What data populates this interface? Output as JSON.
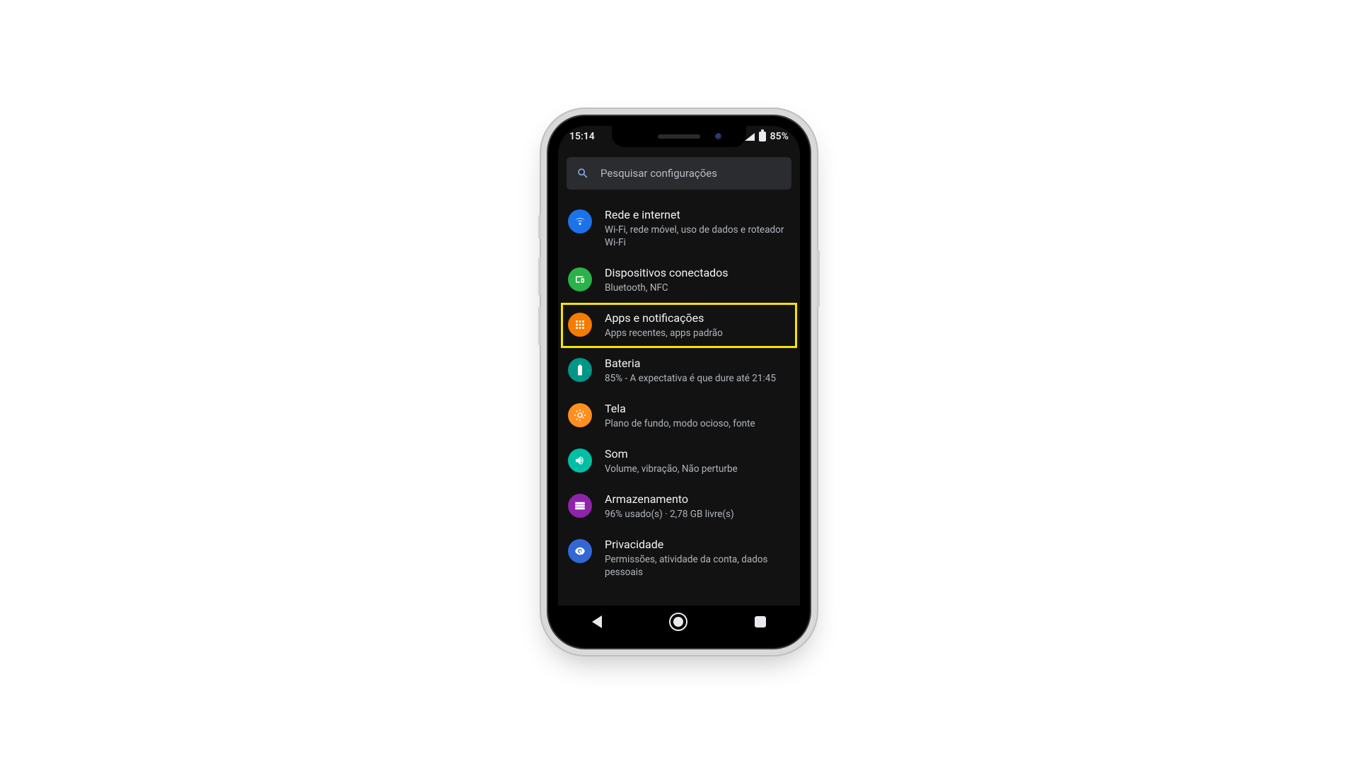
{
  "status": {
    "time": "15:14",
    "battery": "85%"
  },
  "search": {
    "placeholder": "Pesquisar configurações"
  },
  "settings": [
    {
      "id": "network",
      "icon": "wifi-icon",
      "color": "bg-blue",
      "title": "Rede e internet",
      "subtitle": "Wi-Fi, rede móvel, uso de dados e roteador Wi-Fi",
      "highlight": false
    },
    {
      "id": "devices",
      "icon": "devices-icon",
      "color": "bg-green",
      "title": "Dispositivos conectados",
      "subtitle": "Bluetooth, NFC",
      "highlight": false
    },
    {
      "id": "apps",
      "icon": "apps-icon",
      "color": "bg-orange",
      "title": "Apps e notificações",
      "subtitle": "Apps recentes, apps padrão",
      "highlight": true
    },
    {
      "id": "battery",
      "icon": "battery-icon",
      "color": "bg-teal",
      "title": "Bateria",
      "subtitle": "85% - A expectativa é que dure até 21:45",
      "highlight": false
    },
    {
      "id": "display",
      "icon": "display-icon",
      "color": "bg-orange2",
      "title": "Tela",
      "subtitle": "Plano de fundo, modo ocioso, fonte",
      "highlight": false
    },
    {
      "id": "sound",
      "icon": "sound-icon",
      "color": "bg-teal2",
      "title": "Som",
      "subtitle": "Volume, vibração, Não perturbe",
      "highlight": false
    },
    {
      "id": "storage",
      "icon": "storage-icon",
      "color": "bg-purple",
      "title": "Armazenamento",
      "subtitle": "96% usado(s) · 2,78 GB livre(s)",
      "highlight": false
    },
    {
      "id": "privacy",
      "icon": "privacy-icon",
      "color": "bg-blue2",
      "title": "Privacidade",
      "subtitle": "Permissões, atividade da conta, dados pessoais",
      "highlight": false
    }
  ],
  "icons": {
    "wifi-icon": "wifi",
    "devices-icon": "devices",
    "apps-icon": "apps",
    "battery-icon": "battery",
    "display-icon": "brightness",
    "sound-icon": "volume",
    "storage-icon": "storage",
    "privacy-icon": "privacy"
  }
}
